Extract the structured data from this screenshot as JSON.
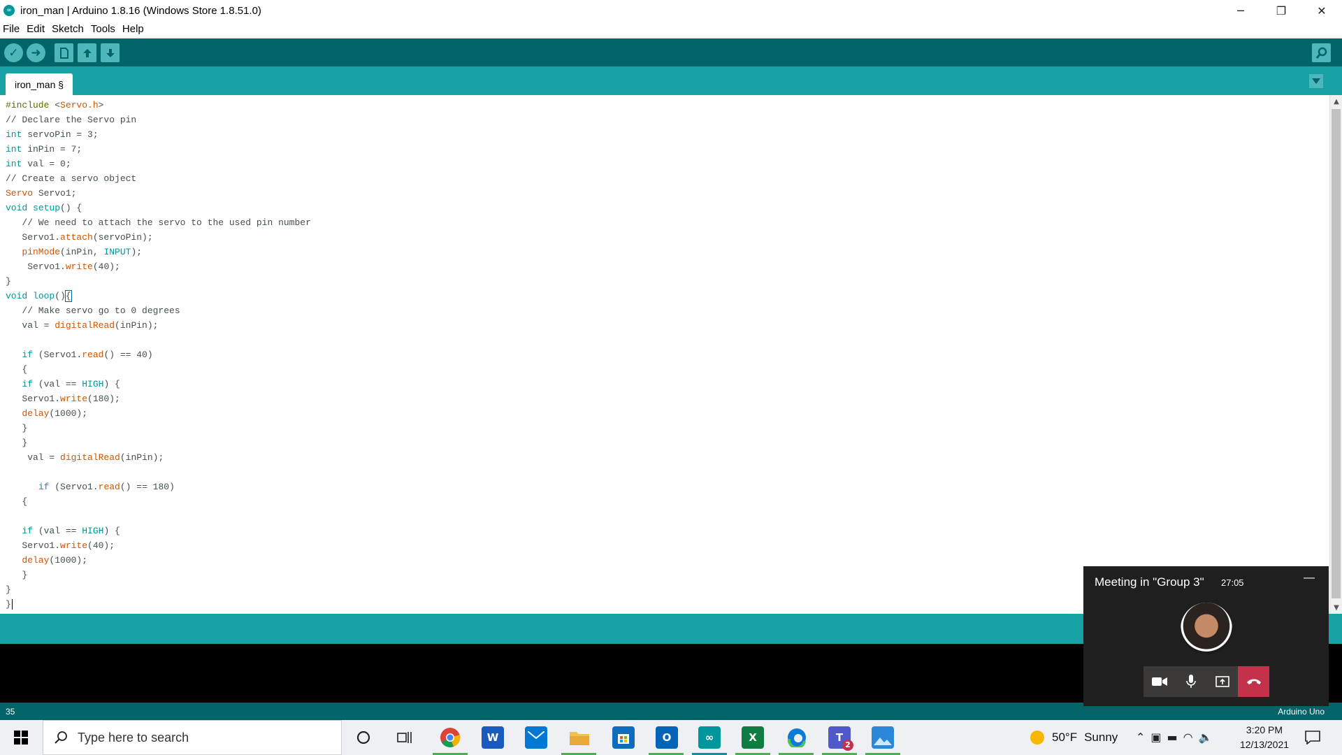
{
  "window": {
    "title": "iron_man | Arduino 1.8.16 (Windows Store 1.8.51.0)",
    "minimize_glyph": "─",
    "restore_glyph": "❐",
    "close_glyph": "✕"
  },
  "menu": [
    "File",
    "Edit",
    "Sketch",
    "Tools",
    "Help"
  ],
  "toolbar": {
    "verify_icon": "checkmark-icon",
    "upload_icon": "arrow-right-icon",
    "new_icon": "new-file-icon",
    "open_icon": "open-arrow-up-icon",
    "save_icon": "save-arrow-down-icon",
    "serial_monitor_icon": "magnifier-icon"
  },
  "tabs": [
    {
      "label": "iron_man §"
    }
  ],
  "code_lines": [
    "#include <Servo.h>",
    "// Declare the Servo pin",
    "int servoPin = 3;",
    "int inPin = 7;",
    "int val = 0;",
    "// Create a servo object",
    "Servo Servo1;",
    "void setup() {",
    "   // We need to attach the servo to the used pin number",
    "   Servo1.attach(servoPin);",
    "   pinMode(inPin, INPUT);",
    "    Servo1.write(40);",
    "}",
    "void loop(){",
    "   // Make servo go to 0 degrees",
    "   val = digitalRead(inPin);",
    "",
    "   if (Servo1.read() == 40)",
    "   {",
    "   if (val == HIGH) {",
    "   Servo1.write(180);",
    "   delay(1000);",
    "   }",
    "   }",
    "    val = digitalRead(inPin);",
    "",
    "      if (Servo1.read() == 180)",
    "   {",
    "",
    "   if (val == HIGH) {",
    "   Servo1.write(40);",
    "   delay(1000);",
    "   }",
    "}",
    "}"
  ],
  "status": {
    "line_number": "35",
    "board": "Arduino Uno"
  },
  "taskbar": {
    "search_placeholder": "Type here to search",
    "apps": [
      "Cortana",
      "Task View",
      "Chrome",
      "Word",
      "Mail",
      "File Explorer",
      "Microsoft Store",
      "Outlook",
      "Arduino",
      "Excel",
      "Edge",
      "Teams",
      "Photos"
    ],
    "teams_badge": "2",
    "weather": {
      "temp": "50°F",
      "condition": "Sunny"
    },
    "time": "3:20 PM",
    "date": "12/13/2021"
  },
  "meeting": {
    "title": "Meeting in \"Group 3\"",
    "elapsed": "27:05",
    "minimize_glyph": "—"
  }
}
